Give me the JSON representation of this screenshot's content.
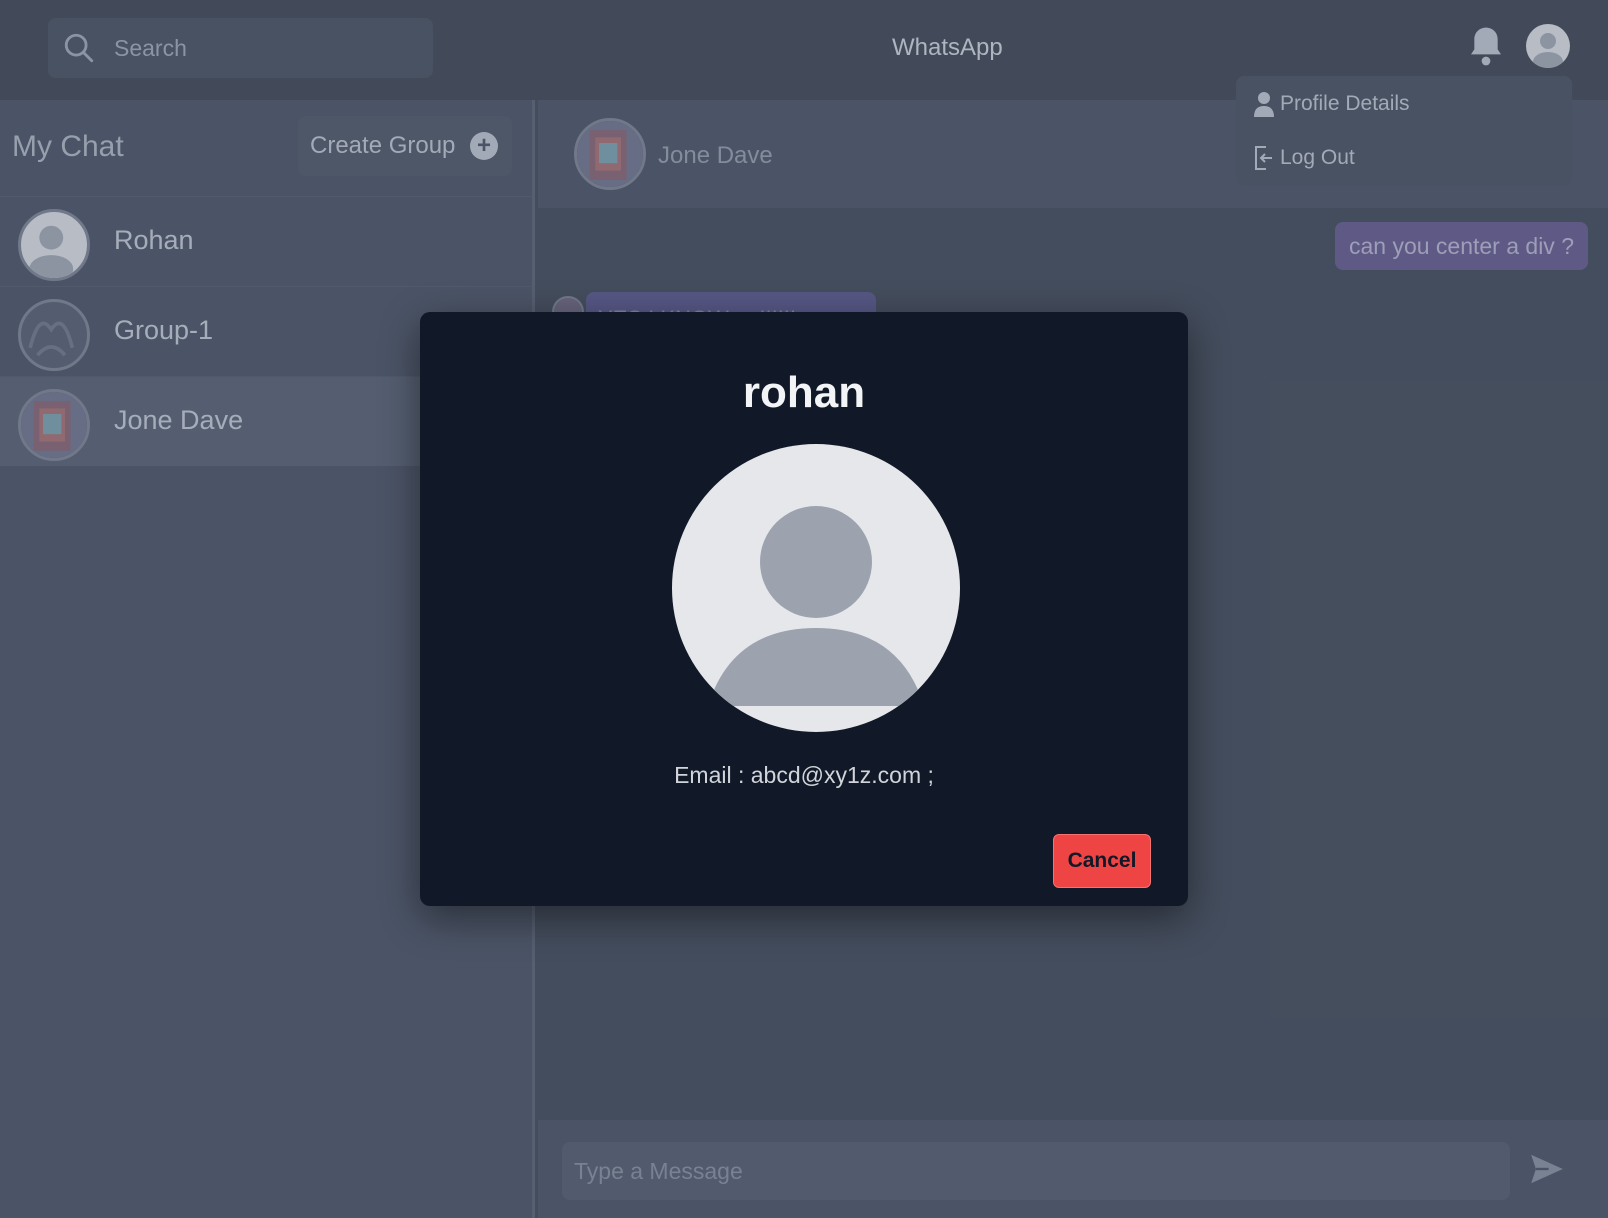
{
  "header": {
    "search_placeholder": "Search",
    "app_title": "WhatsApp"
  },
  "profile_menu": {
    "items": [
      {
        "label": "Profile Details",
        "icon": "person-icon"
      },
      {
        "label": "Log Out",
        "icon": "logout-icon"
      }
    ]
  },
  "sidebar": {
    "title": "My Chat",
    "create_group_label": "Create Group",
    "chats": [
      {
        "name": "Rohan",
        "avatar": "default-avatar"
      },
      {
        "name": "Group-1",
        "avatar": "group-avatar"
      },
      {
        "name": "Jone Dave",
        "avatar": "photo-avatar",
        "active": true
      }
    ]
  },
  "chat": {
    "contact_name": "Jone Dave",
    "messages": [
      {
        "direction": "outgoing",
        "text": "can you center a div ?"
      },
      {
        "direction": "incoming",
        "text": "YES I KNOW ... !!!!!!"
      }
    ],
    "input_placeholder": "Type a Message"
  },
  "modal": {
    "title": "rohan",
    "email_text": "Email : abcd@xy1z.com ;",
    "cancel_label": "Cancel"
  },
  "colors": {
    "accent_purple": "#4c3f7c",
    "cancel_red": "#ef4444",
    "modal_bg": "#111827"
  }
}
